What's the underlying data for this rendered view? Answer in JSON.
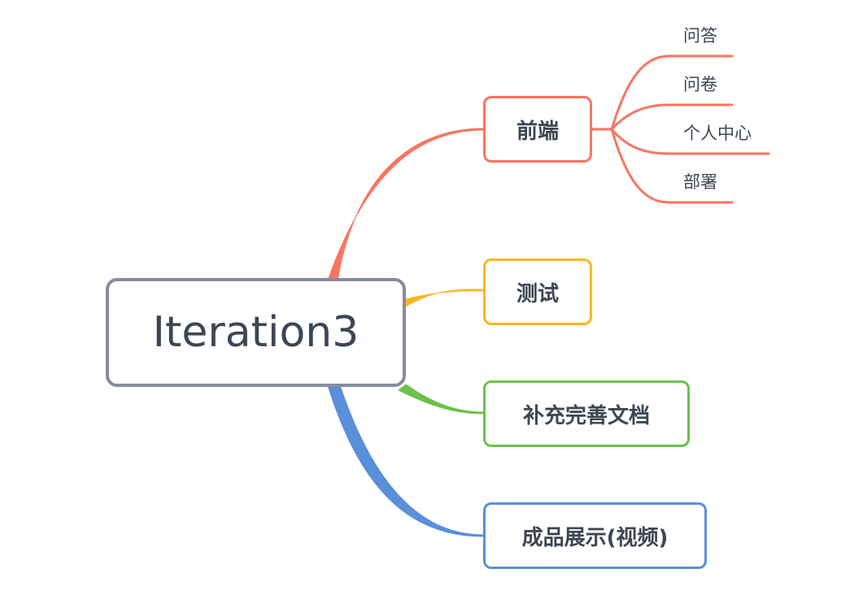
{
  "mindmap": {
    "root": {
      "label": "Iteration3",
      "color": "#858d9c"
    },
    "branches": [
      {
        "label": "前端",
        "color": "#f87562",
        "children": [
          "问答",
          "问卷",
          "个人中心",
          "部署"
        ]
      },
      {
        "label": "测试",
        "color": "#fcb623",
        "children": []
      },
      {
        "label": "补充完善文档",
        "color": "#6cc14c",
        "children": []
      },
      {
        "label": "成品展示(视频)",
        "color": "#5a8fd9",
        "children": []
      }
    ]
  }
}
